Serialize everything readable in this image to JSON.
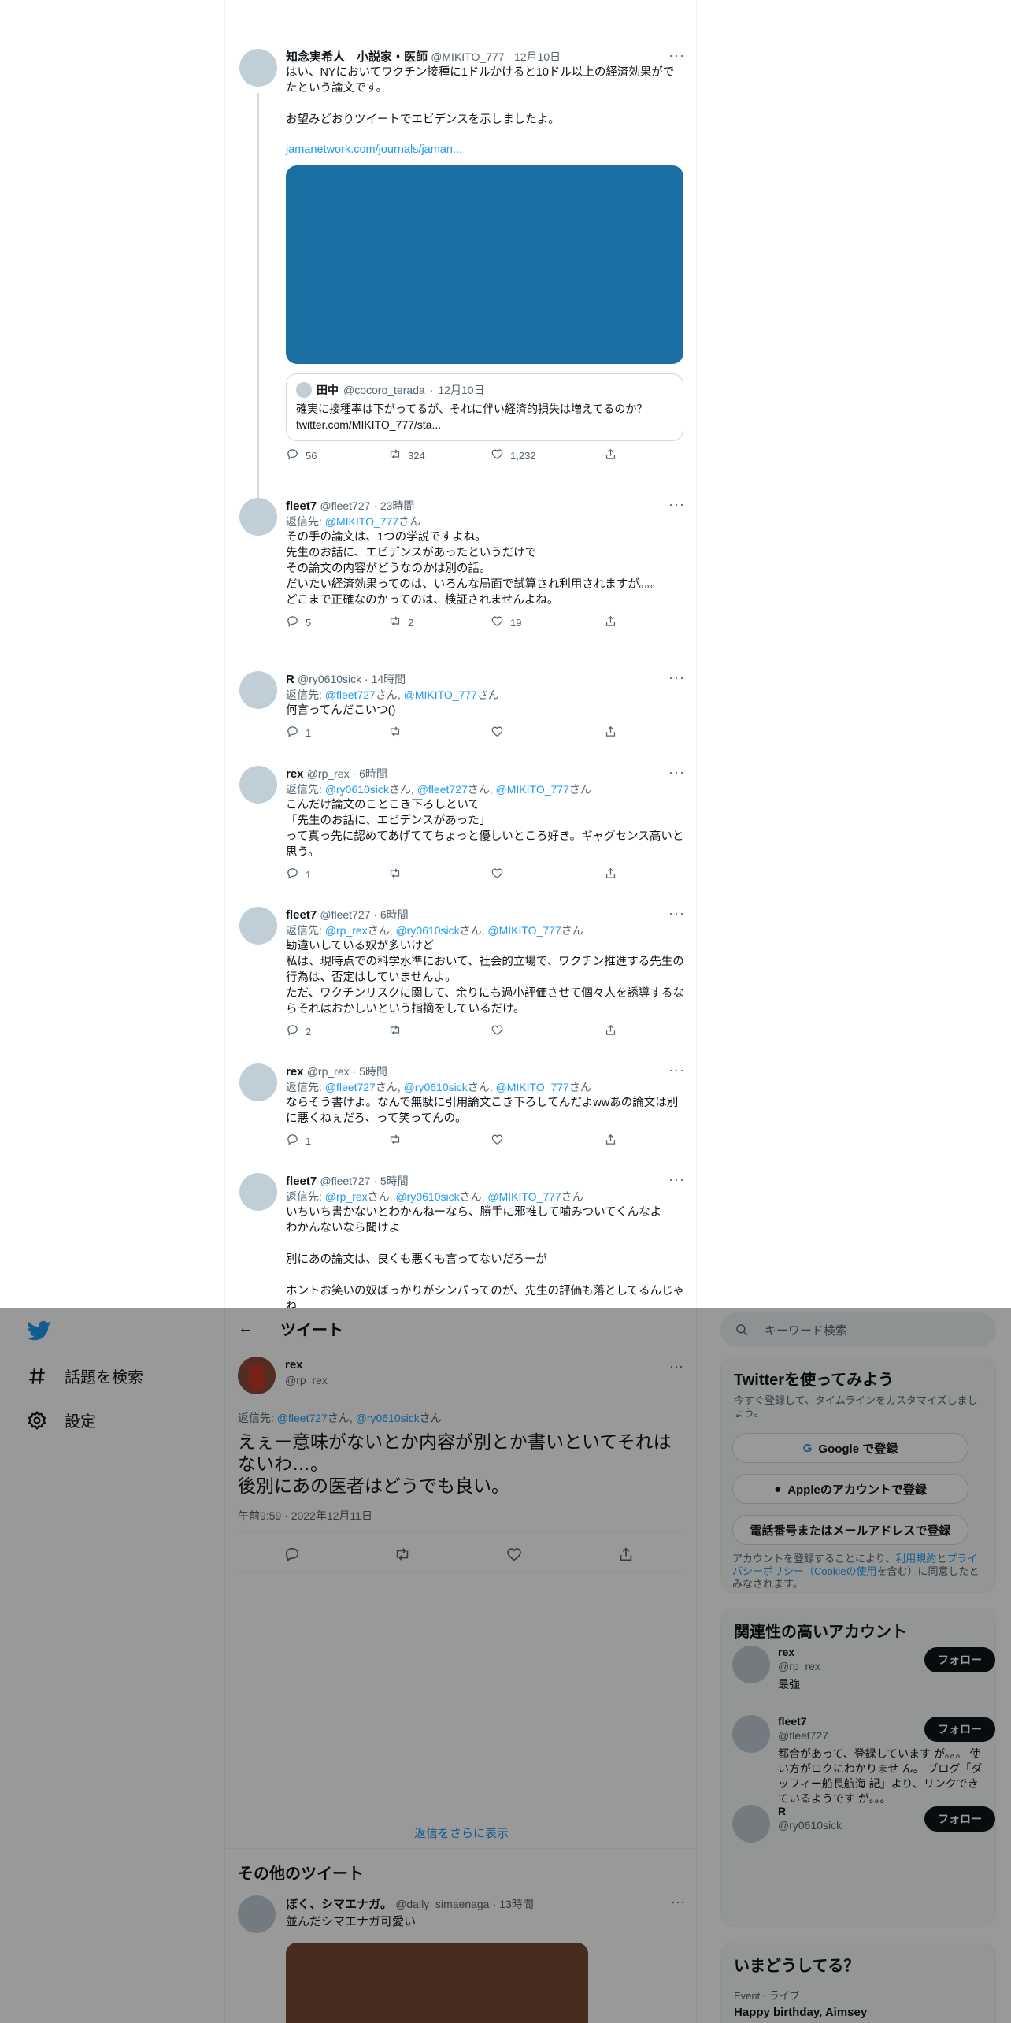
{
  "thread": {
    "tweets": [
      {
        "name": "知念実希人　小説家・医師",
        "handle": "@MIKITO_777",
        "time": "12月10日",
        "text": "はい、NYにおいてワクチン接種に1ドルかけると10ドル以上の経済効果がでたという論文です。\n\nお望みどおりツイートでエビデンスを示しましたよ。",
        "link": "jamanetwork.com/journals/jaman...",
        "quote": {
          "name": "田中",
          "handle": "@cocoro_terada",
          "time": "12月10日",
          "text": "確実に接種率は下がってるが、それに伴い経済的損失は増えてるのか？",
          "link": "twitter.com/MIKITO_777/sta..."
        },
        "replies": "56",
        "retweets": "324",
        "likes": "1,232"
      },
      {
        "name": "fleet7",
        "handle": "@fleet727",
        "time": "23時間",
        "reply_label": "返信先: ",
        "reply_to": "@MIKITO_777",
        "reply_suffix": "さん",
        "text": "その手の論文は、1つの学説ですよね。\n先生のお話に、エビデンスがあったというだけで\nその論文の内容がどうなのかは別の話。\nだいたい経済効果ってのは、いろんな局面で試算され利用されますが。。。\nどこまで正確なのかってのは、検証されませんよね。",
        "replies": "5",
        "retweets": "2",
        "likes": "19"
      },
      {
        "name": "R",
        "handle": "@ry0610sick",
        "time": "14時間",
        "reply_html": "返信先: <span class=\"blue\">@fleet727</span>さん, <span class=\"blue\">@MIKITO_777</span>さん",
        "text": "何言ってんだこいつ()",
        "replies": "1",
        "retweets": "",
        "likes": ""
      },
      {
        "name": "rex",
        "handle": "@rp_rex",
        "time": "6時間",
        "reply_html": "返信先: <span class=\"blue\">@ry0610sick</span>さん, <span class=\"blue\">@fleet727</span>さん, <span class=\"blue\">@MIKITO_777</span>さん",
        "text": "こんだけ論文のことこき下ろしといて\n「先生のお話に、エビデンスがあった」\nって真っ先に認めてあげててちょっと優しいところ好き。ギャグセンス高いと思う。",
        "replies": "1",
        "retweets": "",
        "likes": ""
      },
      {
        "name": "fleet7",
        "handle": "@fleet727",
        "time": "6時間",
        "reply_html": "返信先: <span class=\"blue\">@rp_rex</span>さん, <span class=\"blue\">@ry0610sick</span>さん, <span class=\"blue\">@MIKITO_777</span>さん",
        "text": "勘違いしている奴が多いけど\n私は、現時点での科学水準において、社会的立場で、ワクチン推進する先生の行為は、否定はしていませんよ。\nただ、ワクチンリスクに関して、余りにも過小評価させて個々人を誘導するならそれはおかしいという指摘をしているだけ。",
        "replies": "2",
        "retweets": "",
        "likes": ""
      },
      {
        "name": "rex",
        "handle": "@rp_rex",
        "time": "5時間",
        "reply_html": "返信先: <span class=\"blue\">@fleet727</span>さん, <span class=\"blue\">@ry0610sick</span>さん, <span class=\"blue\">@MIKITO_777</span>さん",
        "text": "ならそう書けよ。なんで無駄に引用論文こき下ろしてんだよwwあの論文は別に悪くねぇだろ、って笑ってんの。",
        "replies": "1",
        "retweets": "",
        "likes": ""
      },
      {
        "name": "fleet7",
        "handle": "@fleet727",
        "time": "5時間",
        "reply_html": "返信先: <span class=\"blue\">@rp_rex</span>さん, <span class=\"blue\">@ry0610sick</span>さん, <span class=\"blue\">@MIKITO_777</span>さん",
        "text": "いちいち書かないとわかんねーなら、勝手に邪推して噛みついてくんなよ\nわかんないなら聞けよ\n\n別にあの論文は、良くも悪くも言ってないだろーが\n\nホントお笑いの奴ばっかりがシンパってのが、先生の評価も落としてるんじゃね",
        "replies": "",
        "retweets": "",
        "likes": ""
      }
    ]
  },
  "nav": {
    "explore": "話題を検索",
    "settings": "設定"
  },
  "main": {
    "back": "←",
    "title": "ツイート",
    "focus": {
      "name": "rex",
      "handle": "@rp_rex",
      "reply_html": "返信先: <span class=\"blue\">@fleet727</span>さん, <span class=\"blue\">@ry0610sick</span>さん",
      "text": "えぇー意味がないとか内容が別とか書いといてそれはないわ…。\n後別にあの医者はどうでも良い。",
      "timestamp": "午前9:59 · 2022年12月11日"
    },
    "show_more": "返信をさらに表示",
    "other_title": "その他のツイート",
    "other": {
      "name": "ぼく、シマエナガ。",
      "handle": "@daily_simaenaga",
      "time": "13時間",
      "text": "並んだシマエナガ可愛い"
    }
  },
  "sidebar": {
    "search_placeholder": "キーワード検索",
    "signup": {
      "title": "Twitterを使ってみよう",
      "sub": "今すぐ登録して、タイムラインをカスタマイズしましょう。",
      "google": "Google で登録",
      "apple": "Appleのアカウントで登録",
      "phone": "電話番号またはメールアドレスで登録",
      "legal_html": "アカウントを登録することにより、<span class=\"blue\">利用規約</span>と<span class=\"blue\">プライバシーポリシー（Cookieの使用</span>を含む）に同意したとみなされます。"
    },
    "related": {
      "title": "関連性の高いアカウント",
      "follow": "フォロー",
      "accounts": [
        {
          "name": "rex",
          "handle": "@rp_rex",
          "bio": "最強"
        },
        {
          "name": "fleet7",
          "handle": "@fleet727",
          "bio": "都合があって、登録しています が。。。 使い方がロクにわかりませ ん。 ブログ「ダッフィー船長航海 記」より、リンクできているようです が。。。"
        },
        {
          "name": "R",
          "handle": "@ry0610sick",
          "bio": ""
        }
      ]
    },
    "trends": {
      "title": "いまどうしてる？",
      "meta": "Event · ライブ",
      "item": "Happy birthday, Aimsey"
    }
  }
}
